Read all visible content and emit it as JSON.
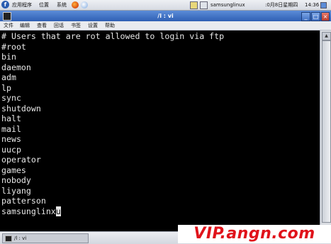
{
  "top_panel": {
    "menus": [
      "应用程序",
      "位置",
      "系统"
    ],
    "user": "samsunglinux",
    "datetime": ":0月8日星期四",
    "clock": "14:36"
  },
  "window": {
    "title": "/l : vi",
    "buttons": {
      "minimize": "_",
      "maximize": "□",
      "close": "×"
    }
  },
  "menubar": {
    "items": [
      "文件",
      "编辑",
      "查看",
      "回话",
      "书签",
      "设置",
      "帮助"
    ]
  },
  "terminal": {
    "lines": [
      "# Users that are rot allowed to login via ftp",
      "#root",
      "bin",
      "daemon",
      "adm",
      "lp",
      "sync",
      "shutdown",
      "halt",
      "mail",
      "news",
      "uucp",
      "operator",
      "games",
      "nobody",
      "liyang",
      "patterson",
      "samsunglinx"
    ],
    "cursor_char": "u"
  },
  "taskbar": {
    "task_label": "/l : vi"
  },
  "watermark": "VIP.angn.com"
}
